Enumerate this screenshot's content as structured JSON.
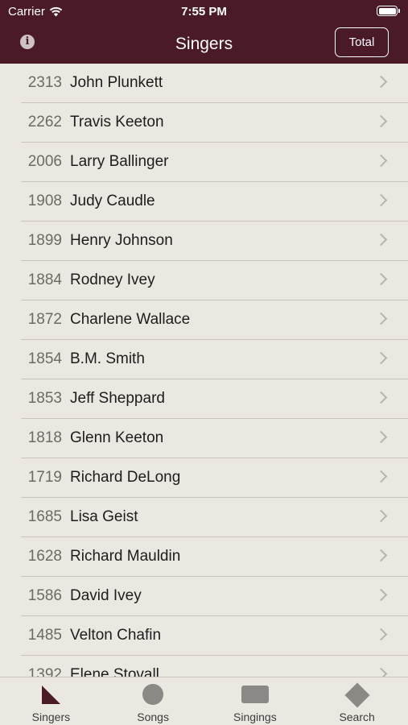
{
  "status_bar": {
    "carrier": "Carrier",
    "time": "7:55 PM"
  },
  "header": {
    "title": "Singers",
    "total_label": "Total",
    "info_glyph": "i"
  },
  "singers": [
    {
      "count": "2313",
      "name": "John Plunkett"
    },
    {
      "count": "2262",
      "name": "Travis Keeton"
    },
    {
      "count": "2006",
      "name": "Larry Ballinger"
    },
    {
      "count": "1908",
      "name": "Judy Caudle"
    },
    {
      "count": "1899",
      "name": "Henry Johnson"
    },
    {
      "count": "1884",
      "name": "Rodney Ivey"
    },
    {
      "count": "1872",
      "name": "Charlene Wallace"
    },
    {
      "count": "1854",
      "name": "B.M. Smith"
    },
    {
      "count": "1853",
      "name": "Jeff Sheppard"
    },
    {
      "count": "1818",
      "name": "Glenn Keeton"
    },
    {
      "count": "1719",
      "name": "Richard DeLong"
    },
    {
      "count": "1685",
      "name": "Lisa Geist"
    },
    {
      "count": "1628",
      "name": "Richard Mauldin"
    },
    {
      "count": "1586",
      "name": "David Ivey"
    },
    {
      "count": "1485",
      "name": "Velton Chafin"
    },
    {
      "count": "1392",
      "name": "Elene Stovall"
    }
  ],
  "tabs": [
    {
      "label": "Singers",
      "icon": "triangle-icon",
      "selected": true
    },
    {
      "label": "Songs",
      "icon": "circle-icon",
      "selected": false
    },
    {
      "label": "Singings",
      "icon": "square-icon",
      "selected": false
    },
    {
      "label": "Search",
      "icon": "diamond-icon",
      "selected": false
    }
  ],
  "colors": {
    "header_bg": "#4a1a27",
    "list_bg": "#ebe8e2",
    "accent": "#4a1a27",
    "inactive_icon": "#8a8986"
  }
}
